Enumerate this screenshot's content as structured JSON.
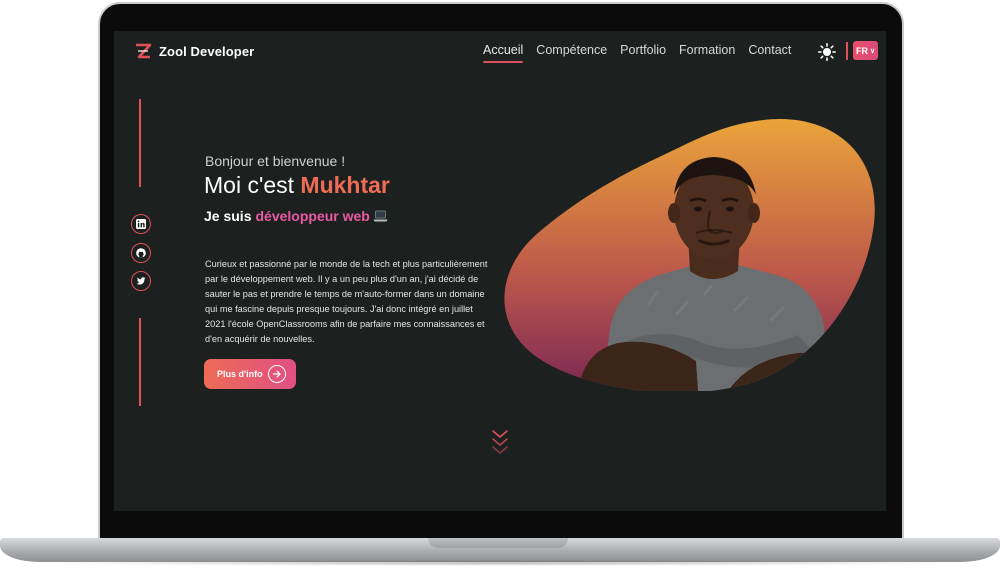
{
  "nav": {
    "brand_name": "Zool Developer",
    "menu": [
      {
        "label": "Accueil",
        "active": true
      },
      {
        "label": "Compétence",
        "active": false
      },
      {
        "label": "Portfolio",
        "active": false
      },
      {
        "label": "Formation",
        "active": false
      },
      {
        "label": "Contact",
        "active": false
      }
    ],
    "theme_icon": "sun-icon",
    "language": "FR"
  },
  "social": [
    {
      "icon": "linkedin-icon"
    },
    {
      "icon": "github-icon"
    },
    {
      "icon": "twitter-icon"
    }
  ],
  "hero": {
    "greeting": "Bonjour et bienvenue !",
    "intro_prefix": "Moi c'est",
    "name": "Mukhtar",
    "role_prefix": "Je suis",
    "role": "développeur web",
    "about": "Curieux et passionné par le monde de la tech et plus particulièrement par le développement web. Il y a un peu plus d'un an, j'ai décidé de sauter le pas et prendre le temps de m'auto-former dans un domaine qui me fascine depuis presque toujours. J'ai donc intégré en juillet 2021 l'école OpenClassrooms afin de parfaire mes connaissances et d'en acquérir de nouvelles.",
    "cta_label": "Plus d'info"
  },
  "colors": {
    "accent": "#e0505a",
    "name": "#ee6b56",
    "role": "#e95aa0",
    "background": "#1c2120",
    "blob_top": "#eaa43a",
    "blob_bottom": "#7a2755"
  }
}
